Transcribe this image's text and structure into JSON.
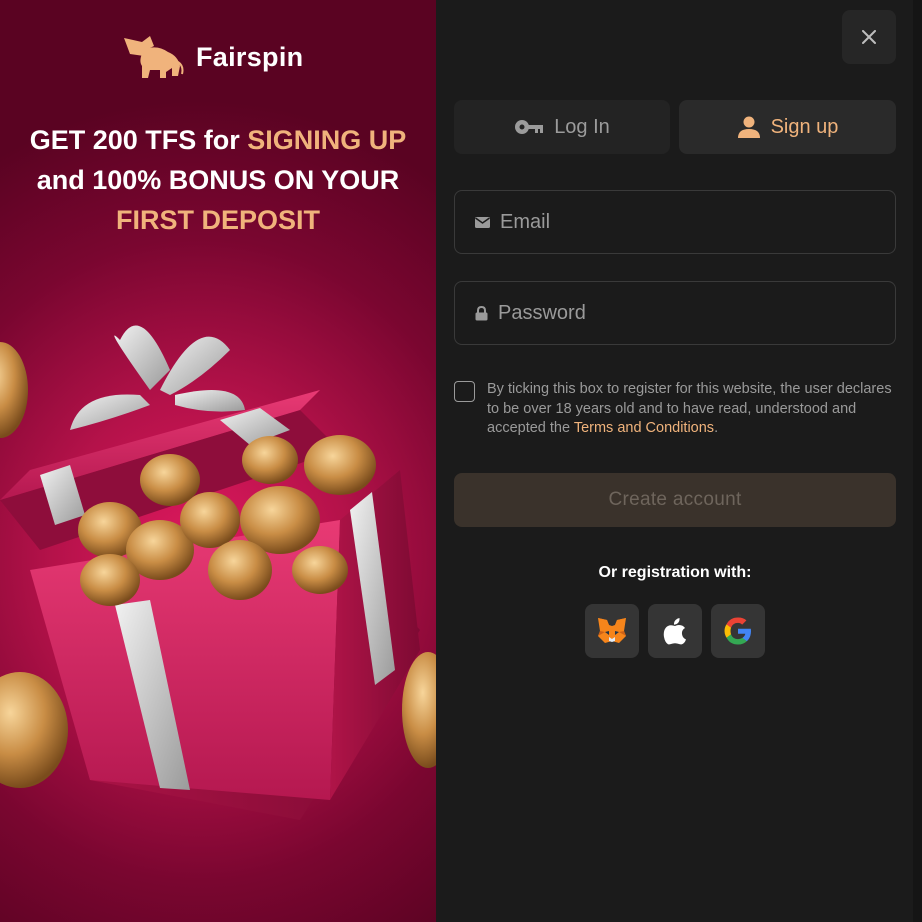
{
  "brand": {
    "name": "Fairspin"
  },
  "promo": {
    "line1_plain": "GET 200 TFS for ",
    "line1_accent": "SIGNING UP",
    "line2": "and 100% BONUS ON YOUR",
    "line3_accent": "FIRST DEPOSIT"
  },
  "tabs": {
    "login_label": "Log In",
    "signup_label": "Sign up"
  },
  "form": {
    "email_placeholder": "Email",
    "password_placeholder": "Password",
    "consent_text": "By ticking this box to register for this website, the user declares to be over 18 years old and to have read, understood and accepted the ",
    "terms_link": "Terms and Conditions",
    "consent_end": ".",
    "consent_checked": false,
    "create_label": "Create account"
  },
  "social": {
    "heading": "Or registration with:",
    "providers": [
      "metamask-icon",
      "apple-icon",
      "google-icon"
    ]
  },
  "icons": {
    "close": "close-icon",
    "key": "key-icon",
    "user": "user-icon",
    "mail": "mail-icon",
    "lock": "lock-icon"
  },
  "colors": {
    "accent": "#f0b37c",
    "panel_bg": "#1b1b1b",
    "promo_bg": "#b5124a",
    "button_disabled": "#3a322b"
  }
}
